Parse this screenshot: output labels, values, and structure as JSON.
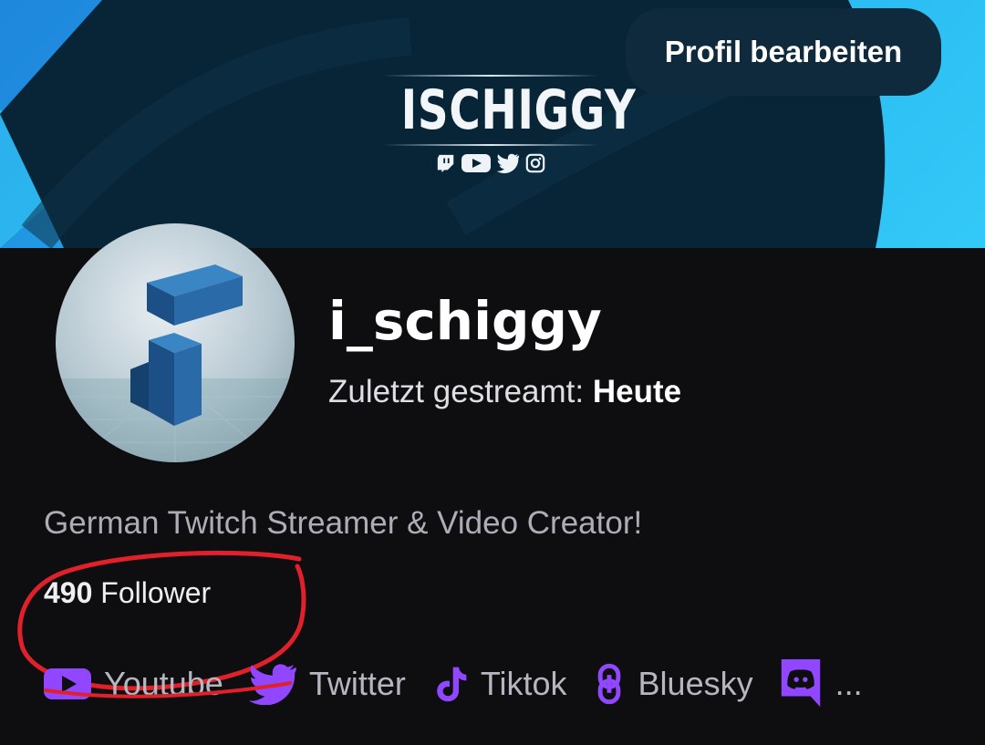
{
  "banner": {
    "logo_text": "ISCHIGGY",
    "logo_socials": [
      "twitch-icon",
      "youtube-icon",
      "twitter-icon",
      "instagram-icon"
    ]
  },
  "header": {
    "edit_profile_label": "Profil bearbeiten"
  },
  "profile": {
    "username": "i_schiggy",
    "last_streamed_label": "Zuletzt gestreamt:",
    "last_streamed_value": "Heute",
    "bio": "German Twitch Streamer & Video Creator!",
    "follower_count": "490",
    "follower_label": "Follower"
  },
  "social_links": [
    {
      "label": "Youtube",
      "icon": "youtube-icon"
    },
    {
      "label": "Twitter",
      "icon": "twitter-icon"
    },
    {
      "label": "Tiktok",
      "icon": "tiktok-icon"
    },
    {
      "label": "Bluesky",
      "icon": "bluesky-icon"
    },
    {
      "label": "...",
      "icon": "discord-icon"
    }
  ],
  "colors": {
    "accent": "#9147ff",
    "background": "#0e0e10",
    "annotation": "#e0202a"
  }
}
